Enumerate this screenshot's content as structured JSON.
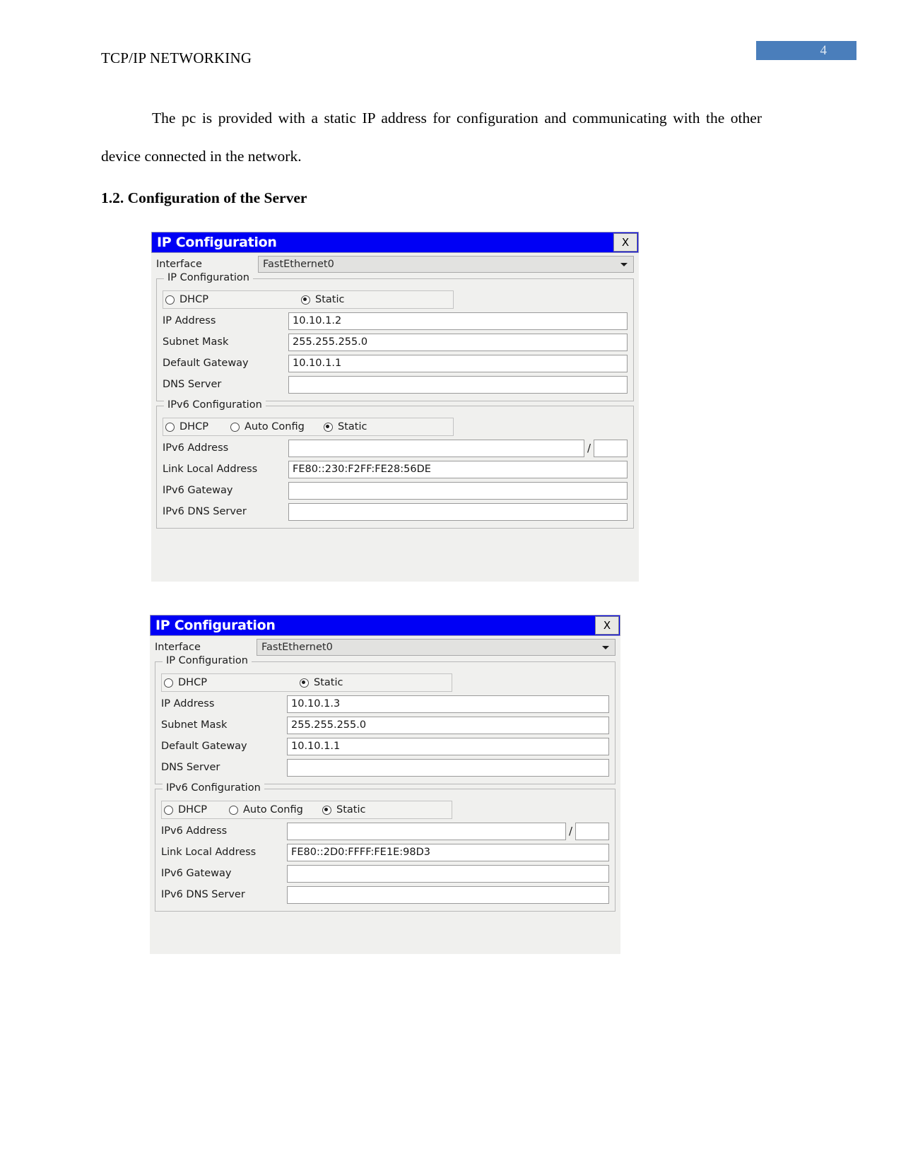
{
  "document": {
    "header_title": "TCP/IP NETWORKING",
    "page_number": "4",
    "page_number_color": "#4a7ebb",
    "paragraph": "The pc is provided with a static IP address for configuration and communicating with the other device connected in the network.",
    "section_heading": "1.2. Configuration of the Server"
  },
  "dialogs": [
    {
      "title": "IP Configuration",
      "close_label": "X",
      "interface": {
        "label": "Interface",
        "value": "FastEthernet0",
        "arrow_icon": "chevron-down-icon"
      },
      "ipv4_group": {
        "title": "IP Configuration",
        "dhcp_label": "DHCP",
        "static_label": "Static",
        "selected": "Static",
        "fields": [
          {
            "label": "IP Address",
            "value": "10.10.1.2"
          },
          {
            "label": "Subnet Mask",
            "value": "255.255.255.0"
          },
          {
            "label": "Default Gateway",
            "value": "10.10.1.1"
          },
          {
            "label": "DNS Server",
            "value": ""
          }
        ]
      },
      "ipv6_group": {
        "title": "IPv6 Configuration",
        "dhcp_label": "DHCP",
        "autoconfig_label": "Auto Config",
        "static_label": "Static",
        "selected": "Static",
        "address_label": "IPv6 Address",
        "address_value": "",
        "prefix_separator": "/",
        "prefix_value": "",
        "fields": [
          {
            "label": "Link Local Address",
            "value": "FE80::230:F2FF:FE28:56DE"
          },
          {
            "label": "IPv6 Gateway",
            "value": ""
          },
          {
            "label": "IPv6 DNS Server",
            "value": ""
          }
        ]
      }
    },
    {
      "title": "IP Configuration",
      "close_label": "X",
      "interface": {
        "label": "Interface",
        "value": "FastEthernet0",
        "arrow_icon": "chevron-down-icon"
      },
      "ipv4_group": {
        "title": "IP Configuration",
        "dhcp_label": "DHCP",
        "static_label": "Static",
        "selected": "Static",
        "fields": [
          {
            "label": "IP Address",
            "value": "10.10.1.3"
          },
          {
            "label": "Subnet Mask",
            "value": "255.255.255.0"
          },
          {
            "label": "Default Gateway",
            "value": "10.10.1.1"
          },
          {
            "label": "DNS Server",
            "value": ""
          }
        ]
      },
      "ipv6_group": {
        "title": "IPv6 Configuration",
        "dhcp_label": "DHCP",
        "autoconfig_label": "Auto Config",
        "static_label": "Static",
        "selected": "Static",
        "address_label": "IPv6 Address",
        "address_value": "",
        "prefix_separator": "/",
        "prefix_value": "",
        "fields": [
          {
            "label": "Link Local Address",
            "value": "FE80::2D0:FFFF:FE1E:98D3"
          },
          {
            "label": "IPv6 Gateway",
            "value": ""
          },
          {
            "label": "IPv6 DNS Server",
            "value": ""
          }
        ]
      }
    }
  ]
}
